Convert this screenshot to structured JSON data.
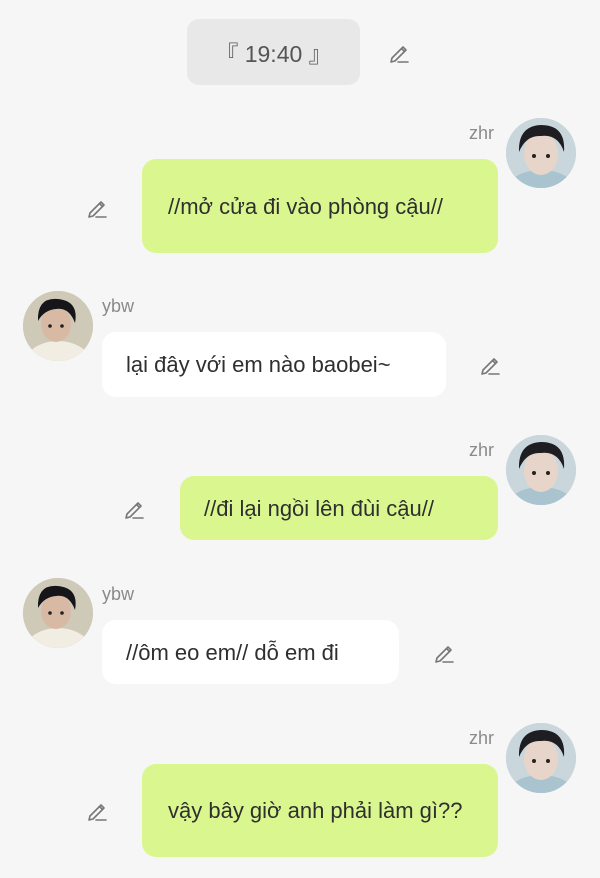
{
  "time_chip": {
    "text": "『 19:40 』"
  },
  "messages": [
    {
      "sender": "zhr",
      "side": "right",
      "text": "//mở cửa đi vào phòng cậu//"
    },
    {
      "sender": "ybw",
      "side": "left",
      "text": "lại đây với em nào baobei~"
    },
    {
      "sender": "zhr",
      "side": "right",
      "text": "//đi lại ngồi lên đùi cậu//"
    },
    {
      "sender": "ybw",
      "side": "left",
      "text": "//ôm eo em// dỗ em đi"
    },
    {
      "sender": "zhr",
      "side": "right",
      "text": "vậy bây giờ anh phải làm gì??"
    }
  ],
  "icons": {
    "edit": "pencil-edit-icon",
    "avatar_zhr": "avatar-zhr",
    "avatar_ybw": "avatar-ybw"
  },
  "colors": {
    "background": "#f6f6f6",
    "bubble_right": "#daf78f",
    "bubble_left": "#ffffff",
    "time_chip": "#e8e8e8",
    "name_text": "#8a8a8a"
  }
}
